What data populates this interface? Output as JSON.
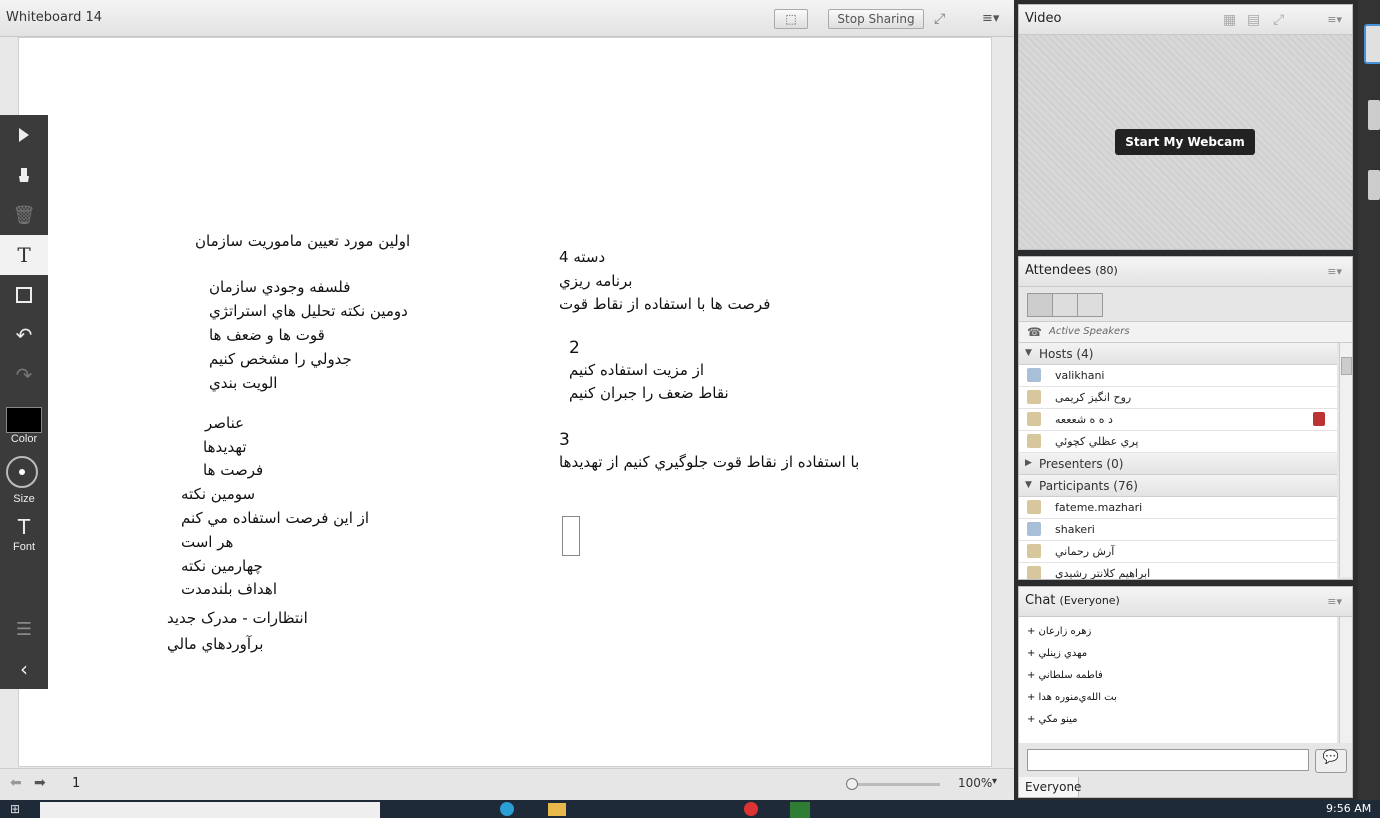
{
  "whiteboard": {
    "title": "Whiteboard 14",
    "stop_sharing": "Stop Sharing",
    "page_number": "1",
    "zoom": "100%",
    "left_column": [
      "اولین مورد تعیین ماموریت سازمان",
      "فلسفه وجودي سازمان",
      "دومین نکته تحلیل هاي استراتژي",
      "قوت ها و ضعف ها",
      "جدولي را مشخص کنیم",
      "الویت بندي",
      "عناصر",
      "تهدیدها",
      "فرصت ها",
      "سومین نکته",
      "از این فرصت استفاده مي کنم",
      "هر است",
      "چهارمین نکته",
      "اهداف بلندمدت",
      "انتظارات - مدرک جدید",
      "برآوردهاي مالي"
    ],
    "right_column": [
      "دسته 4",
      "برنامه ریزي",
      "فرصت ها با استفاده از نقاط قوت",
      "2",
      "از مزیت استفاده کنیم",
      "نقاط ضعف را جبران کنیم",
      "3",
      "با استفاده از نقاط قوت جلوگیري کنیم از تهدیدها"
    ],
    "toolbar": {
      "color_label": "Color",
      "size_label": "Size",
      "font_label": "Font",
      "text_tool_glyph": "T",
      "current_color": "#000000"
    }
  },
  "video": {
    "title": "Video",
    "start_webcam": "Start My Webcam"
  },
  "attendees": {
    "title": "Attendees",
    "count": "(80)",
    "active_speakers": "Active Speakers",
    "hosts_label": "Hosts (4)",
    "hosts": [
      "valikhani",
      "روح انگیز کریمی",
      "ﺩ ﻩ ﻩ ﺷﻌﻌﻌﻪ",
      "پري عظلي کچوئي"
    ],
    "presenters_label": "Presenters (0)",
    "participants_label": "Participants (76)",
    "participants": [
      "fateme.mazhari",
      "shakeri",
      "آرش رحماني",
      "ابراهیم کلانتر رشیدي"
    ]
  },
  "chat": {
    "title": "Chat",
    "scope": "(Everyone)",
    "messages": [
      "زهره زارعان +",
      "مهدي زينلي +",
      "فاطمه سلطاني +",
      "بت الله‌ي‌منوره هدا +",
      "مینو مکي +"
    ],
    "recipient": "Everyone"
  },
  "taskbar": {
    "time": "9:56 AM"
  },
  "colors": {
    "toolbar_bg": "#3b3b3b",
    "taskbar_bg": "#1f2a38",
    "webcam_btn_bg": "#222222"
  }
}
